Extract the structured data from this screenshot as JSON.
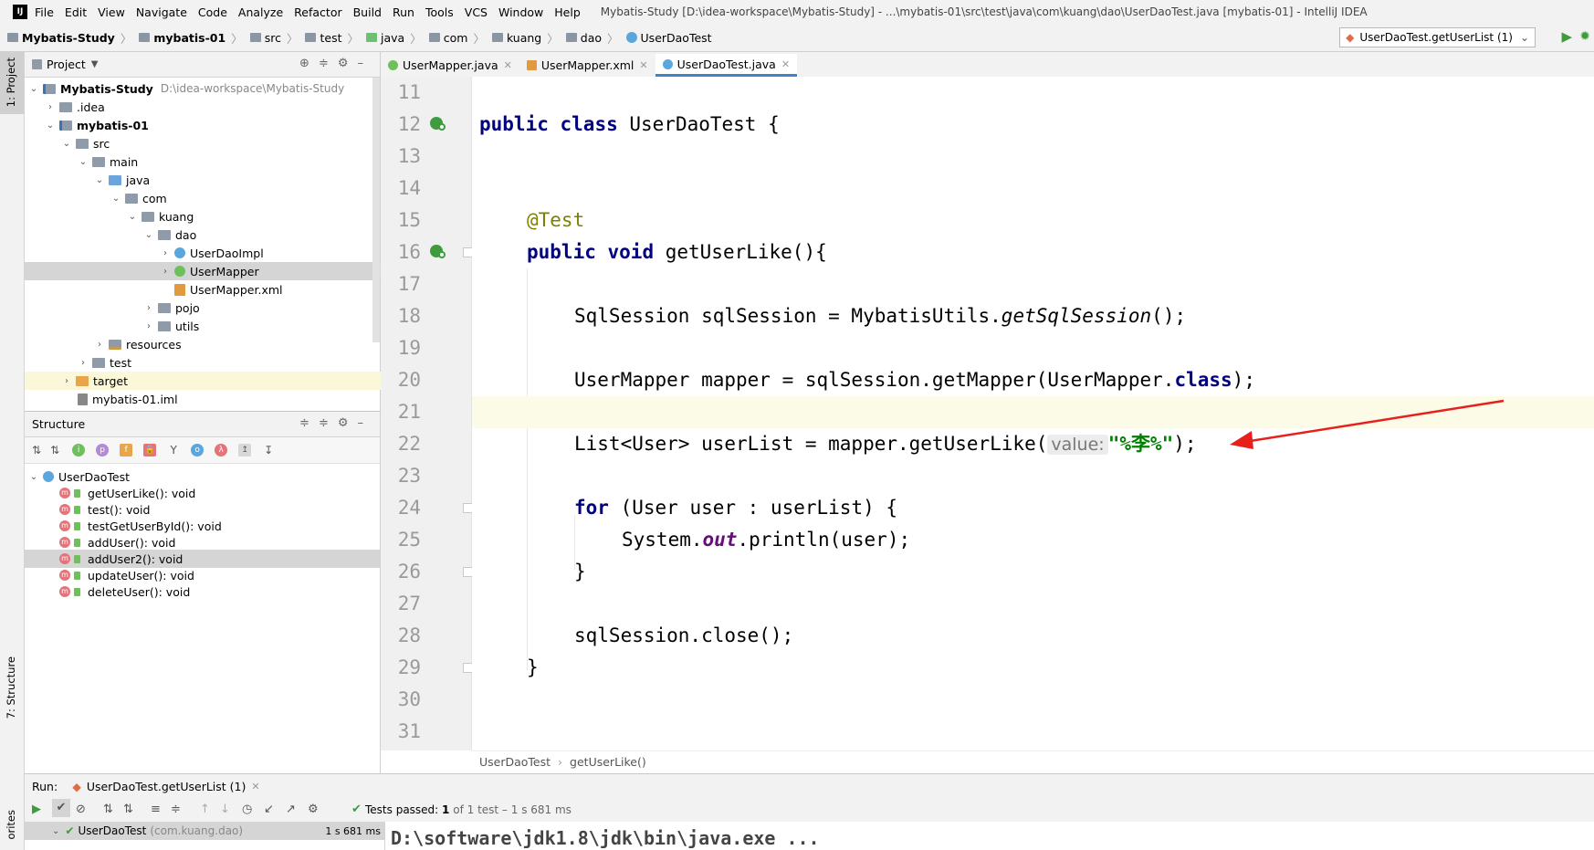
{
  "app": {
    "logo": "IJ",
    "menu": [
      "File",
      "Edit",
      "View",
      "Navigate",
      "Code",
      "Analyze",
      "Refactor",
      "Build",
      "Run",
      "Tools",
      "VCS",
      "Window",
      "Help"
    ],
    "title": "Mybatis-Study [D:\\idea-workspace\\Mybatis-Study] - ...\\mybatis-01\\src\\test\\java\\com\\kuang\\dao\\UserDaoTest.java [mybatis-01] - IntelliJ IDEA"
  },
  "breadcrumbs": [
    "Mybatis-Study",
    "mybatis-01",
    "src",
    "test",
    "java",
    "com",
    "kuang",
    "dao",
    "UserDaoTest"
  ],
  "run_config": "UserDaoTest.getUserList (1)",
  "left_strip": {
    "project_tab": "1: Project",
    "structure_tab": "7: Structure",
    "favorites_tab": "orites"
  },
  "project_panel": {
    "title": "Project",
    "tree": [
      {
        "label": "Mybatis-Study",
        "extra": "D:\\idea-workspace\\Mybatis-Study",
        "bold": true
      },
      {
        "label": ".idea"
      },
      {
        "label": "mybatis-01",
        "bold": true
      },
      {
        "label": "src"
      },
      {
        "label": "main"
      },
      {
        "label": "java"
      },
      {
        "label": "com"
      },
      {
        "label": "kuang"
      },
      {
        "label": "dao"
      },
      {
        "label": "UserDaoImpl"
      },
      {
        "label": "UserMapper"
      },
      {
        "label": "UserMapper.xml"
      },
      {
        "label": "pojo"
      },
      {
        "label": "utils"
      },
      {
        "label": "resources"
      },
      {
        "label": "test"
      },
      {
        "label": "target"
      },
      {
        "label": "mybatis-01.iml"
      }
    ]
  },
  "structure_panel": {
    "title": "Structure",
    "class_name": "UserDaoTest",
    "methods": [
      "getUserLike(): void",
      "test(): void",
      "testGetUserById(): void",
      "addUser(): void",
      "addUser2(): void",
      "updateUser(): void",
      "deleteUser(): void"
    ]
  },
  "editor": {
    "tabs": [
      "UserMapper.java",
      "UserMapper.xml",
      "UserDaoTest.java"
    ],
    "line_numbers": [
      "11",
      "12",
      "13",
      "14",
      "15",
      "16",
      "17",
      "18",
      "19",
      "20",
      "21",
      "22",
      "23",
      "24",
      "25",
      "26",
      "27",
      "28",
      "29",
      "30",
      "31"
    ],
    "tokens": {
      "l12_kw1": "public",
      "l12_kw2": "class",
      "l12_rest": " UserDaoTest {",
      "l15_ann": "@Test",
      "l16_kw1": "public",
      "l16_kw2": "void",
      "l16_rest": " getUserLike(){",
      "l18_a": "SqlSession sqlSession = MybatisUtils.",
      "l18_b": "getSqlSession",
      "l18_c": "();",
      "l20_a": "UserMapper mapper = sqlSession.getMapper(UserMapper.",
      "l20_b": "class",
      "l20_c": ");",
      "l22_a": "List<User> userList = mapper.getUserLike(",
      "l22_hint": "value:",
      "l22_str": "\"%李%\"",
      "l22_c": ");",
      "l24_kw": "for",
      "l24_rest": " (User user : userList) {",
      "l25_a": "System.",
      "l25_b": "out",
      "l25_c": ".println(user);",
      "l26": "}",
      "l28": "sqlSession.close();",
      "l29": "}"
    },
    "breadcrumb": [
      "UserDaoTest",
      "getUserLike()"
    ]
  },
  "run_panel": {
    "label": "Run:",
    "tab": "UserDaoTest.getUserList (1)",
    "status_prefix": "Tests passed:",
    "status_count": "1",
    "status_rest": "of 1 test – 1 s 681 ms",
    "tree_item": "UserDaoTest",
    "tree_pkg": "(com.kuang.dao)",
    "tree_time": "1 s 681 ms",
    "console_line": "D:\\software\\jdk1.8\\jdk\\bin\\java.exe ..."
  },
  "colors": {
    "keyword": "#000080",
    "string": "#008000",
    "annotation": "#808000",
    "arrow": "#e8201c",
    "tab_underline": "#4083c9"
  }
}
